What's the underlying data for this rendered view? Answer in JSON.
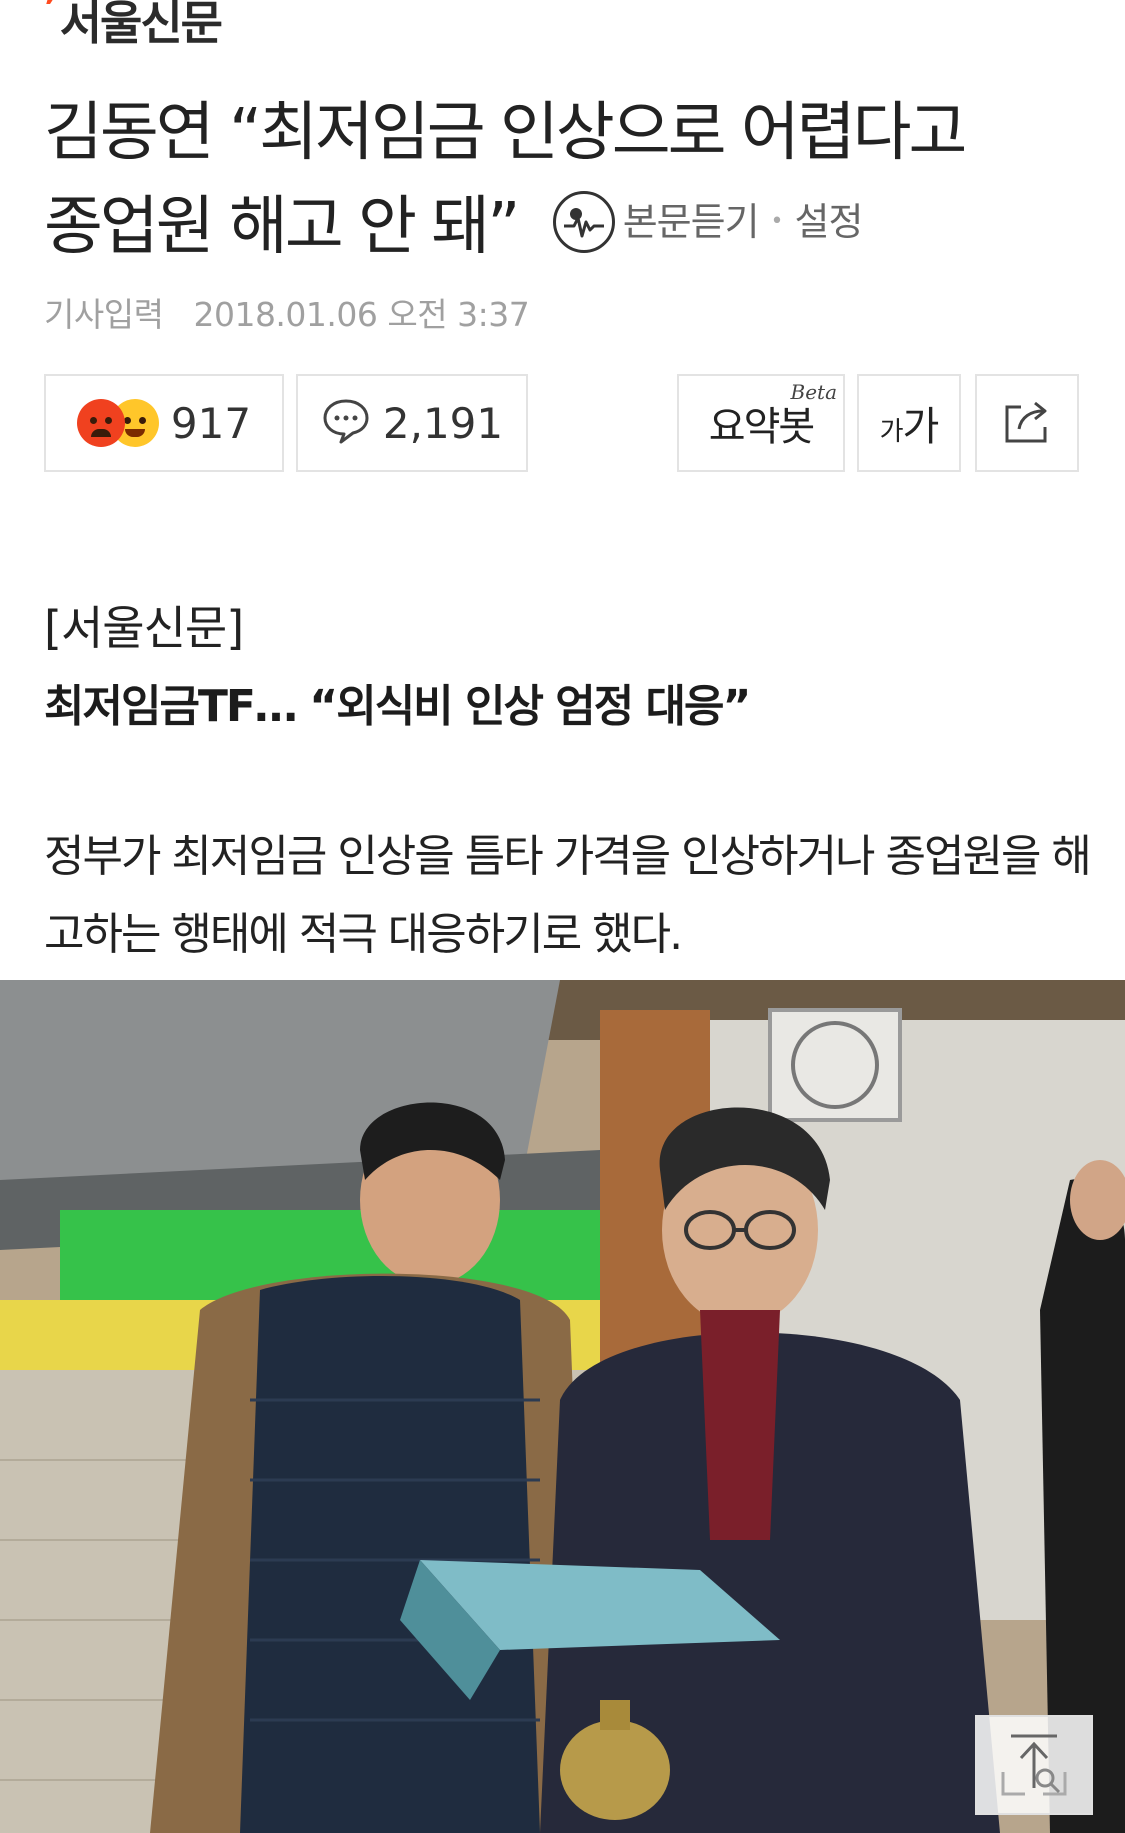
{
  "press": {
    "name": "서울신문"
  },
  "article": {
    "headline_line1": "김동연 “최저임금 인상으로 어렵다고",
    "headline_line2": "종업원 해고 안 돼”",
    "tts_label": "본문듣기",
    "tts_settings": "설정",
    "published_label": "기사입력",
    "published_datetime": "2018.01.06 오전 3:37",
    "source": "[서울신문]",
    "subheading": "최저임금TF… “외식비 인상 엄정 대응”",
    "body": "정부가 최저임금 인상을 틈타 가격을 인상하거나 종업원을 해고하는 행태에 적극 대응하기로 했다."
  },
  "toolbar": {
    "reaction_count": "917",
    "comment_count": "2,191",
    "summary_label": "요약봇",
    "summary_badge": "Beta",
    "font_small": "가",
    "font_large": "가"
  },
  "colors": {
    "press_accent": "#ff4b1f",
    "angry_emoji": "#f0411f",
    "laugh_emoji": "#ffc62a",
    "meta_text": "#a0a0a0",
    "button_border": "#e3e3e3"
  },
  "icons": {
    "tts": "sound-wave-icon",
    "comment": "speech-bubble-icon",
    "share": "share-arrow-icon",
    "scroll_top": "scroll-to-top-icon"
  }
}
